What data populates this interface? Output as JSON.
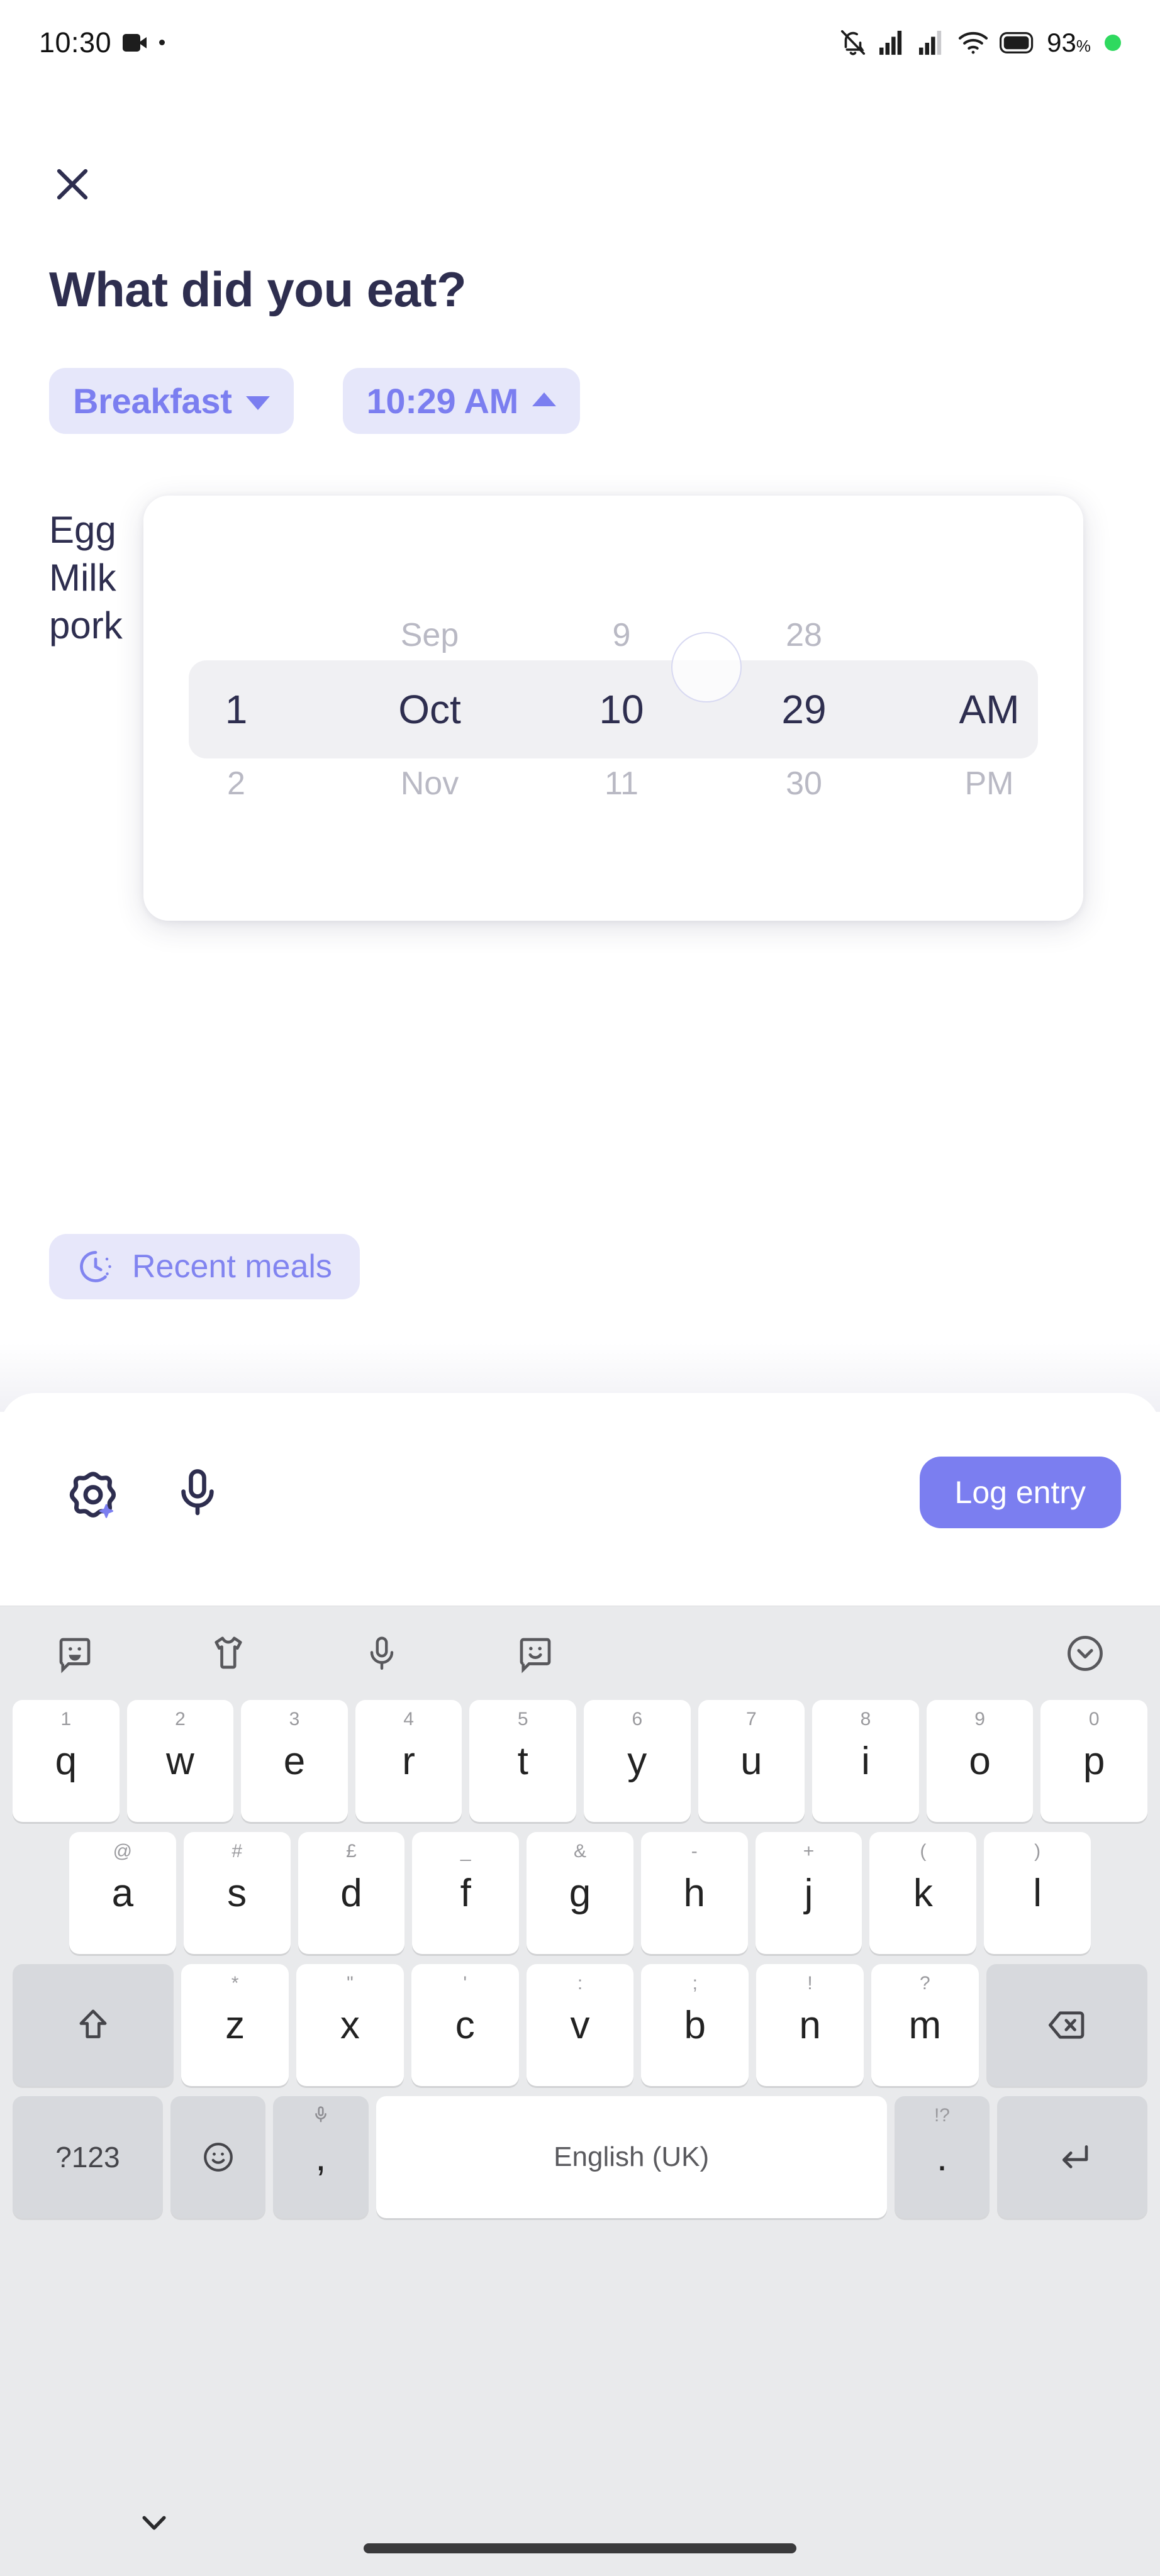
{
  "status_bar": {
    "time": "10:30",
    "battery_percent": "93",
    "percent_symbol": "%",
    "icons": [
      "video-camera-icon",
      "recording-dot-icon",
      "vibrate-mute-icon",
      "signal-bars-1-icon",
      "signal-bars-2-icon",
      "wifi-icon",
      "battery-icon",
      "green-status-dot-icon"
    ]
  },
  "header": {
    "close_label": "close-icon",
    "title": "What did you eat?"
  },
  "chips": {
    "meal_type": "Breakfast",
    "meal_type_caret": "chevron-down-icon",
    "time": "10:29 AM",
    "time_caret": "chevron-up-icon"
  },
  "meal_text": "Egg\nMilk\npork",
  "picker": {
    "columns": [
      {
        "name": "day",
        "above": "",
        "selected": "1",
        "below": "2"
      },
      {
        "name": "month",
        "above": "Sep",
        "selected": "Oct",
        "below": "Nov"
      },
      {
        "name": "hour",
        "above": "9",
        "selected": "10",
        "below": "11"
      },
      {
        "name": "minute",
        "above": "28",
        "selected": "29",
        "below": "30"
      },
      {
        "name": "ampm",
        "above": "",
        "selected": "AM",
        "below": "PM"
      }
    ]
  },
  "recent_meals": {
    "icon": "recent-history-clock-icon",
    "label": "Recent meals"
  },
  "input_bar": {
    "camera_icon": "camera-sparkle-icon",
    "mic_icon": "microphone-icon",
    "submit_label": "Log entry"
  },
  "keyboard": {
    "toolbar_icons": [
      "sticker-face-icon",
      "tshirt-icon",
      "microphone-icon",
      "emoji-smiley-icon",
      "chevron-down-circle-icon"
    ],
    "rows": [
      [
        {
          "main": "q",
          "hint": "1"
        },
        {
          "main": "w",
          "hint": "2"
        },
        {
          "main": "e",
          "hint": "3"
        },
        {
          "main": "r",
          "hint": "4"
        },
        {
          "main": "t",
          "hint": "5"
        },
        {
          "main": "y",
          "hint": "6"
        },
        {
          "main": "u",
          "hint": "7"
        },
        {
          "main": "i",
          "hint": "8"
        },
        {
          "main": "o",
          "hint": "9"
        },
        {
          "main": "p",
          "hint": "0"
        }
      ],
      [
        {
          "main": "a",
          "hint": "@"
        },
        {
          "main": "s",
          "hint": "#"
        },
        {
          "main": "d",
          "hint": "£"
        },
        {
          "main": "f",
          "hint": "_"
        },
        {
          "main": "g",
          "hint": "&"
        },
        {
          "main": "h",
          "hint": "-"
        },
        {
          "main": "j",
          "hint": "+"
        },
        {
          "main": "k",
          "hint": "("
        },
        {
          "main": "l",
          "hint": ")"
        }
      ],
      [
        {
          "main": "z",
          "hint": "*"
        },
        {
          "main": "x",
          "hint": "\""
        },
        {
          "main": "c",
          "hint": "'"
        },
        {
          "main": "v",
          "hint": ":"
        },
        {
          "main": "b",
          "hint": ";"
        },
        {
          "main": "n",
          "hint": "!"
        },
        {
          "main": "m",
          "hint": "?"
        }
      ]
    ],
    "shift_icon": "shift-arrow-icon",
    "backspace_icon": "backspace-icon",
    "symbols_label": "?123",
    "emoji_icon": "emoji-smiley-icon",
    "comma_label": ",",
    "comma_hint_icon": "microphone-icon",
    "space_label": "English (UK)",
    "period_label": ".",
    "period_hint": "!?",
    "enter_icon": "enter-return-icon"
  },
  "navbar": {
    "hide_keyboard_icon": "chevron-down-icon",
    "home_indicator": "home-gesture-bar"
  },
  "colors": {
    "accent": "#7b7ef0",
    "chip_bg": "#e6e7fa",
    "title": "#2e2e4f",
    "picker_band": "#f0f0f3",
    "keyboard_bg": "#e9eaec",
    "battery_dot": "#2fd95f"
  }
}
